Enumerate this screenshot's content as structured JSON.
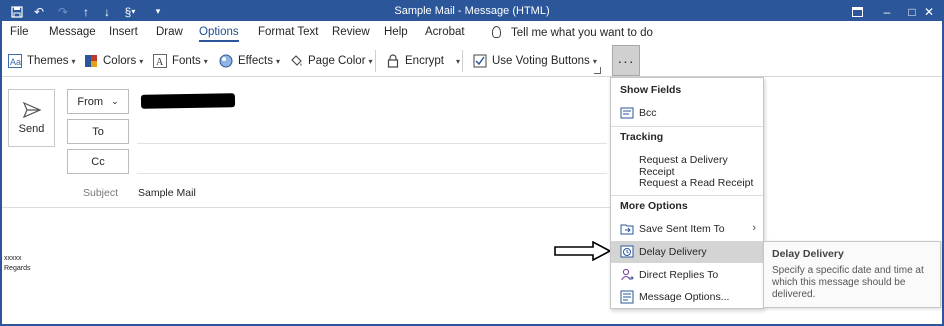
{
  "titlebar": {
    "title": "Sample Mail  -  Message (HTML)",
    "quick_access_icons": [
      "save-icon",
      "undo-icon",
      "redo-icon",
      "up-arrow-icon",
      "down-arrow-icon",
      "paperclip-icon",
      "customize-icon"
    ],
    "window_icons": [
      "restore-window-icon",
      "minimize-icon",
      "maximize-icon",
      "close-icon"
    ]
  },
  "menu": {
    "tabs": [
      "File",
      "Message",
      "Insert",
      "Draw",
      "Options",
      "Format Text",
      "Review",
      "Help",
      "Acrobat"
    ],
    "active_tab": "Options",
    "tell_me": "Tell me what you want to do"
  },
  "ribbon": {
    "themes": "Themes",
    "colors": "Colors",
    "fonts": "Fonts",
    "effects": "Effects",
    "page_color": "Page Color",
    "encrypt": "Encrypt",
    "voting": "Use Voting Buttons",
    "more": "···"
  },
  "compose": {
    "send": "Send",
    "from": "From",
    "to": "To",
    "cc": "Cc",
    "subject_label": "Subject",
    "subject_value": "Sample Mail",
    "body_line1": "xxxxx",
    "body_line2": "Regards"
  },
  "dropdown": {
    "show_fields_header": "Show Fields",
    "bcc": "Bcc",
    "tracking_header": "Tracking",
    "delivery_receipt": "Request a Delivery Receipt",
    "read_receipt": "Request a Read Receipt",
    "more_options_header": "More Options",
    "save_sent": "Save Sent Item To",
    "delay_delivery": "Delay Delivery",
    "direct_replies": "Direct Replies To",
    "message_options": "Message Options..."
  },
  "tooltip": {
    "title": "Delay Delivery",
    "description": "Specify a specific date and time at which this message should be delivered."
  },
  "colors": {
    "title_bar": "#2b579a",
    "highlight": "#d4d4d4",
    "accent": "#1e4e8c"
  }
}
